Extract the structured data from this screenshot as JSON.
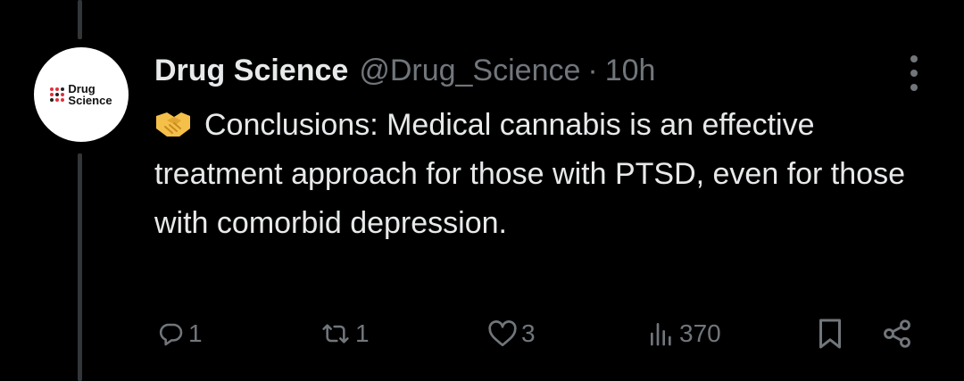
{
  "tweet": {
    "author": {
      "display_name": "Drug Science",
      "handle": "@Drug_Science",
      "avatar_logo_text": "Drug Science"
    },
    "separator": "·",
    "time": "10h",
    "emoji": "handshake",
    "text": "Conclusions: Medical cannabis is an effective treatment approach for those with PTSD, even for those with comorbid depression."
  },
  "actions": {
    "reply_count": "1",
    "retweet_count": "1",
    "like_count": "3",
    "views_count": "370"
  },
  "icons": [
    "more-icon",
    "handshake-icon",
    "reply-icon",
    "retweet-icon",
    "like-icon",
    "views-icon",
    "bookmark-icon",
    "share-icon"
  ],
  "colors": {
    "background": "#000000",
    "text": "#e7e9ea",
    "secondary": "#71767b",
    "thread_line": "#333639",
    "logo_red": "#e0303a"
  }
}
